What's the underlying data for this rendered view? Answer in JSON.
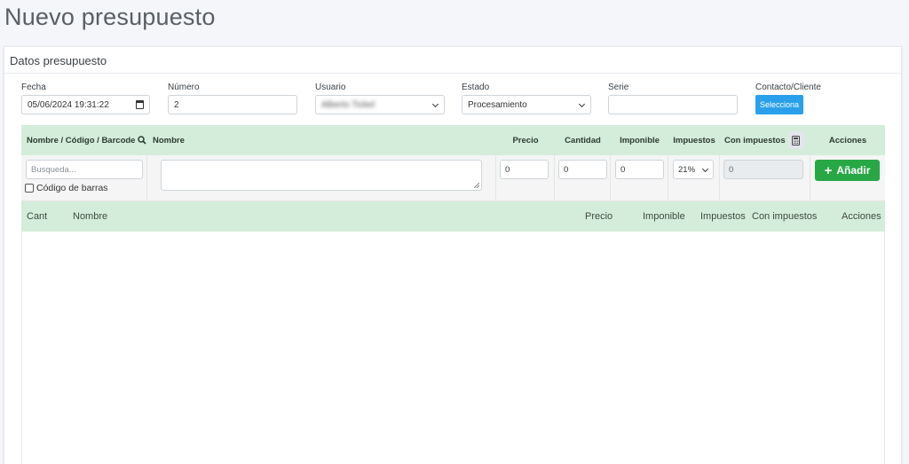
{
  "page": {
    "title": "Nuevo presupuesto"
  },
  "card": {
    "header": "Datos presupuesto"
  },
  "fields": {
    "fecha": {
      "label": "Fecha",
      "value": "05/06/2024 19:31:22"
    },
    "numero": {
      "label": "Número",
      "value": "2"
    },
    "usuario": {
      "label": "Usuario",
      "value": "Alberto Tickel"
    },
    "estado": {
      "label": "Estado",
      "value": "Procesamiento"
    },
    "serie": {
      "label": "Serie",
      "value": ""
    },
    "contacto": {
      "label": "Contacto/Cliente",
      "button": "Selecciona"
    }
  },
  "entry_table": {
    "headers": {
      "codigo": "Nombre / Código / Barcode",
      "nombre": "Nombre",
      "precio": "Precio",
      "cantidad": "Cantidad",
      "imponible": "Imponible",
      "impuestos": "Impuestos",
      "con_impuestos": "Con impuestos",
      "acciones": "Acciones"
    },
    "search_placeholder": "Busqueda...",
    "barcode_checkbox_label": "Código de barras",
    "precio_value": "0",
    "cantidad_value": "0",
    "imponible_value": "0",
    "impuestos_value": "21%",
    "con_impuestos_value": "0",
    "add_button": "Añadir"
  },
  "lines_table": {
    "headers": {
      "cant": "Cant",
      "nombre": "Nombre",
      "precio": "Precio",
      "imponible": "Imponible",
      "impuestos": "Impuestos",
      "con_impuestos": "Con impuestos",
      "acciones": "Acciones"
    }
  },
  "icons": {
    "search": "search-icon",
    "calculator": "calculator-icon",
    "calendar": "calendar-icon",
    "plus": "plus-icon"
  },
  "colors": {
    "primary": "#2aa0ec",
    "success": "#28a745",
    "table_header": "#d4edda"
  }
}
